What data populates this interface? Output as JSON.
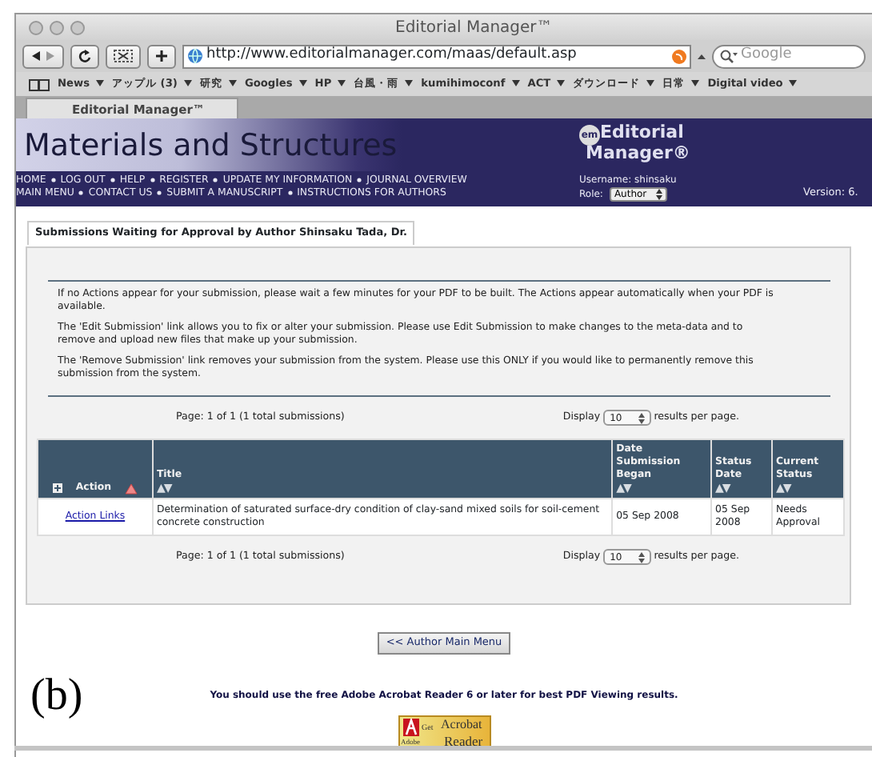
{
  "window": {
    "title": "Editorial Manager™"
  },
  "toolbar": {
    "url": "http://www.editorialmanager.com/maas/default.asp",
    "search_placeholder": "Google"
  },
  "bookmarks": [
    {
      "label": "News"
    },
    {
      "label": "アップル (3)"
    },
    {
      "label": "研究"
    },
    {
      "label": "Googles"
    },
    {
      "label": "HP"
    },
    {
      "label": "台風・雨"
    },
    {
      "label": "kumihimoconf"
    },
    {
      "label": "ACT"
    },
    {
      "label": "ダウンロード"
    },
    {
      "label": "日常"
    },
    {
      "label": "Digital video"
    }
  ],
  "tabs": [
    {
      "label": "Editorial Manager™",
      "selected": true
    }
  ],
  "header": {
    "journal": "Materials and Structures",
    "logo_badge": "em",
    "logo_line1": "Editorial",
    "logo_line2": "Manager®",
    "nav_rows": [
      [
        "HOME",
        "LOG OUT",
        "HELP",
        "REGISTER",
        "UPDATE MY INFORMATION",
        "JOURNAL OVERVIEW"
      ],
      [
        "MAIN MENU",
        "CONTACT US",
        "SUBMIT A MANUSCRIPT",
        "INSTRUCTIONS FOR AUTHORS"
      ]
    ],
    "username": "Username: shinsaku",
    "role_label": "Role:",
    "role": "Author",
    "version": "Version: 6."
  },
  "panel_tab": "Submissions Waiting for Approval by Author Shinsaku Tada, Dr.",
  "notes": [
    "If no Actions appear for your submission, please wait a few minutes for your PDF to be built. The Actions appear automatically when your PDF is available.",
    "The 'Edit Submission' link allows you to fix or alter your submission. Please use Edit Submission to make changes to the meta-data and to remove and upload new files that make up your submission.",
    "The 'Remove Submission' link removes your submission from the system. Please use this ONLY if you would like to permanently remove this submission from the system."
  ],
  "pagers": [
    {
      "page": "Page: 1 of 1 (1 total submissions)",
      "display": "Display",
      "per_page": "10",
      "suffix": "results per page."
    },
    {
      "page": "Page: 1 of 1 (1 total submissions)",
      "display": "Display",
      "per_page": "10",
      "suffix": "results per page."
    }
  ],
  "table": {
    "columns": [
      {
        "label": "Action",
        "kind": "action"
      },
      {
        "label": "Title",
        "kind": "sortable",
        "sort": "▲▼"
      },
      {
        "label": "Date Submission Began",
        "kind": "sortable",
        "sort": "▲▼"
      },
      {
        "label": "Status Date",
        "kind": "sortable",
        "sort": "▲▼"
      },
      {
        "label": "Current Status",
        "kind": "sortable",
        "sort": "▲▼"
      }
    ],
    "rows": [
      [
        "Action Links",
        "Determination of saturated surface-dry condition of clay-sand mixed soils for soil-cement concrete construction",
        "05 Sep 2008",
        "05 Sep 2008",
        "Needs Approval"
      ]
    ]
  },
  "back_button": "<< Author Main Menu",
  "reader_note": "You should use the free Adobe Acrobat Reader 6 or later for best PDF Viewing results.",
  "reader_badge": {
    "brand": "Adobe",
    "get": "Get",
    "line1": "Acrobat",
    "line2": "Reader"
  },
  "figure_label": "(b)"
}
